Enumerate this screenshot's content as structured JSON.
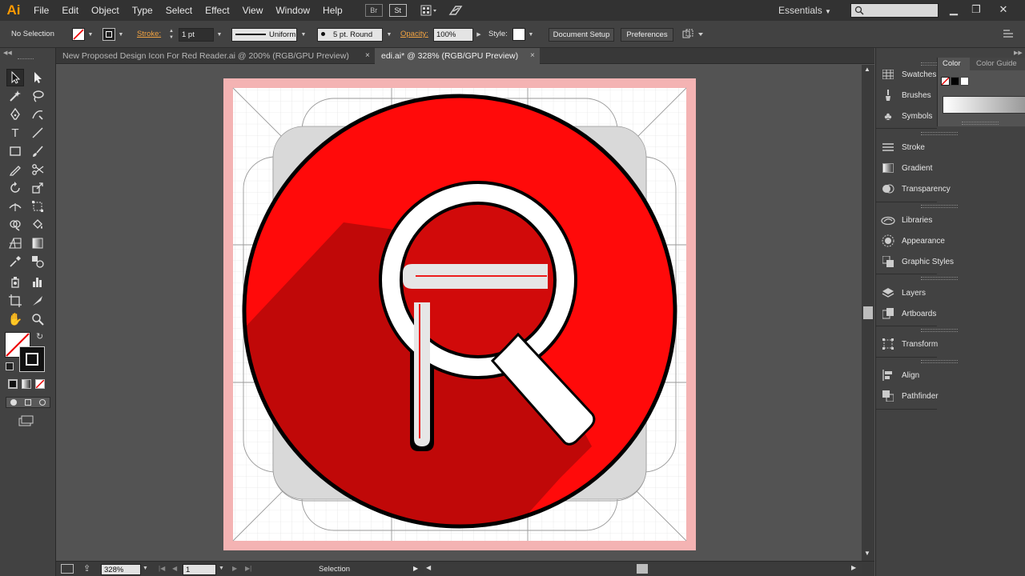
{
  "app": {
    "logo": "Ai"
  },
  "menu": [
    "File",
    "Edit",
    "Object",
    "Type",
    "Select",
    "Effect",
    "View",
    "Window",
    "Help"
  ],
  "menubar_icons": {
    "bridge": "Br",
    "stock": "St"
  },
  "workspace": "Essentials",
  "control": {
    "selection": "No Selection",
    "stroke_label": "Stroke:",
    "stroke_weight": "1 pt",
    "profile": "Uniform",
    "brush": "5 pt. Round",
    "opacity_label": "Opacity:",
    "opacity": "100%",
    "style_label": "Style:",
    "doc_setup": "Document Setup",
    "preferences": "Preferences"
  },
  "tabs": [
    {
      "label": "New Proposed Design Icon For Red Reader.ai @ 200% (RGB/GPU Preview)",
      "active": false
    },
    {
      "label": "edi.ai* @ 328% (RGB/GPU Preview)",
      "active": true
    }
  ],
  "tab_close": "×",
  "status": {
    "zoom": "328%",
    "artboard": "1",
    "tool": "Selection"
  },
  "dock": {
    "group1": [
      "Swatches",
      "Brushes",
      "Symbols"
    ],
    "group2": [
      "Stroke",
      "Gradient",
      "Transparency"
    ],
    "group3": [
      "Libraries",
      "Appearance",
      "Graphic Styles"
    ],
    "group4": [
      "Layers",
      "Artboards"
    ],
    "group5": [
      "Transform"
    ],
    "group6": [
      "Align",
      "Pathfinder"
    ]
  },
  "color_panel": {
    "tab1": "Color",
    "tab2": "Color Guide"
  },
  "colors": {
    "icon_red": "#ff0a0a",
    "shadow_red": "#c00808",
    "accent_orange": "#f2a341",
    "bleed": "#f4b0b0"
  }
}
